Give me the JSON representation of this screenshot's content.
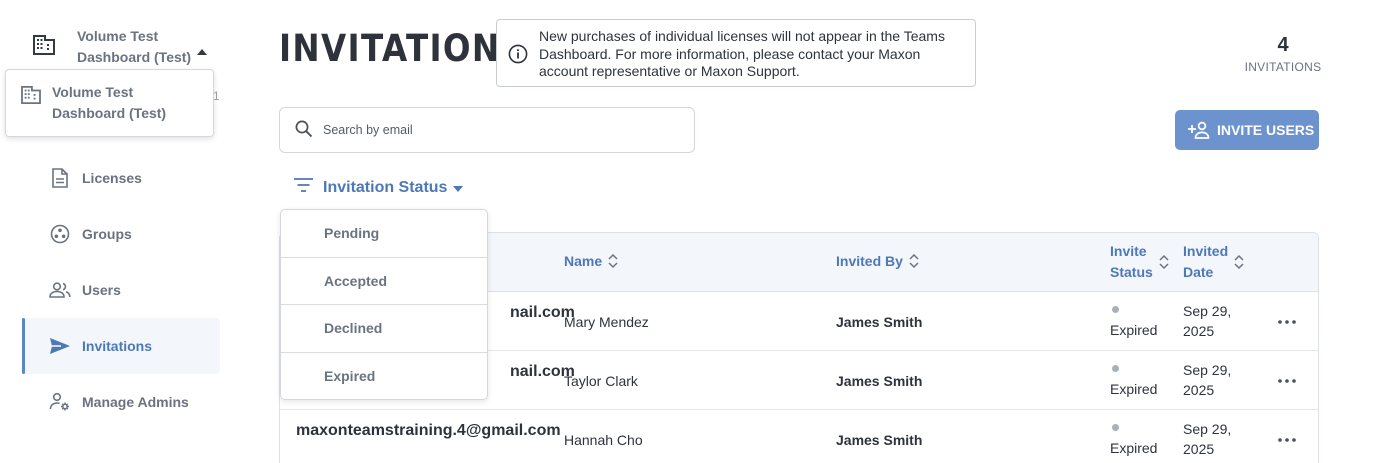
{
  "org": {
    "name": "Volume Test Dashboard (Test)",
    "peek_text": "1"
  },
  "nav": [
    {
      "label": "Licenses",
      "icon": "document-icon",
      "active": false
    },
    {
      "label": "Groups",
      "icon": "groups-icon",
      "active": false
    },
    {
      "label": "Users",
      "icon": "users-icon",
      "active": false
    },
    {
      "label": "Invitations",
      "icon": "send-icon",
      "active": true
    },
    {
      "label": "Manage Admins",
      "icon": "admin-gear-icon",
      "active": false
    }
  ],
  "header": {
    "title": "INVITATIONS",
    "notice": "New purchases of individual licenses will not appear in the Teams Dashboard. For more information, please contact your Maxon account representative or Maxon Support.",
    "count": "4",
    "count_label": "INVITATIONS"
  },
  "search": {
    "placeholder": "Search by email",
    "value": ""
  },
  "invite_button": {
    "label": "INVITE USERS"
  },
  "filter": {
    "label": "Invitation Status",
    "options": [
      "Pending",
      "Accepted",
      "Declined",
      "Expired"
    ]
  },
  "table": {
    "columns": {
      "name": "Name",
      "invited_by": "Invited By",
      "status_line1": "Invite",
      "status_line2": "Status",
      "date_line1": "Invited",
      "date_line2": "Date"
    },
    "rows": [
      {
        "email": "nail.com",
        "name": "Mary Mendez",
        "invited_by": "James Smith",
        "status": "Expired",
        "date_line1": "Sep 29,",
        "date_line2": "2025"
      },
      {
        "email": "nail.com",
        "name": "Taylor Clark",
        "invited_by": "James Smith",
        "status": "Expired",
        "date_line1": "Sep 29,",
        "date_line2": "2025"
      },
      {
        "email": "maxonteamstraining.4@gmail.com",
        "name": "Hannah Cho",
        "invited_by": "James Smith",
        "status": "Expired",
        "date_line1": "Sep 29,",
        "date_line2": "2025"
      }
    ]
  },
  "colors": {
    "accent": "#4d78b8",
    "button": "#6d93cf",
    "muted": "#6b7280",
    "status_dot": "#aab0b9"
  }
}
